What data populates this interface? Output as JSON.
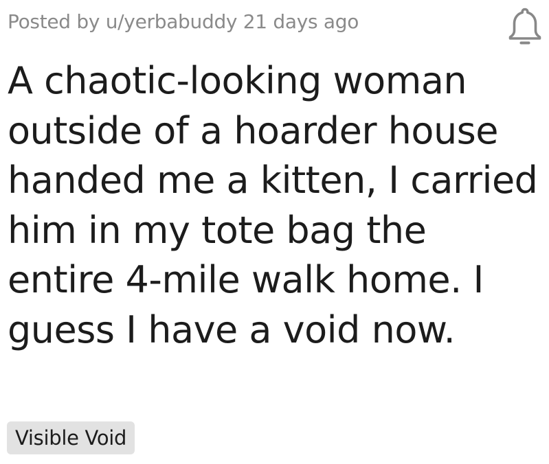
{
  "post": {
    "meta_text": "Posted by u/yerbabuddy 21 days ago",
    "title": "A chaotic-looking woman outside of a hoarder house handed me a kitten, I carried him in my tote bag the entire 4-mile walk home. I guess I have a void now.",
    "flair": "Visible Void",
    "notification_icon": "bell-icon"
  },
  "colors": {
    "meta_text": "#8a8a8a",
    "title_text": "#1c1c1c",
    "flair_background": "#e2e2e2",
    "icon": "#888888"
  }
}
